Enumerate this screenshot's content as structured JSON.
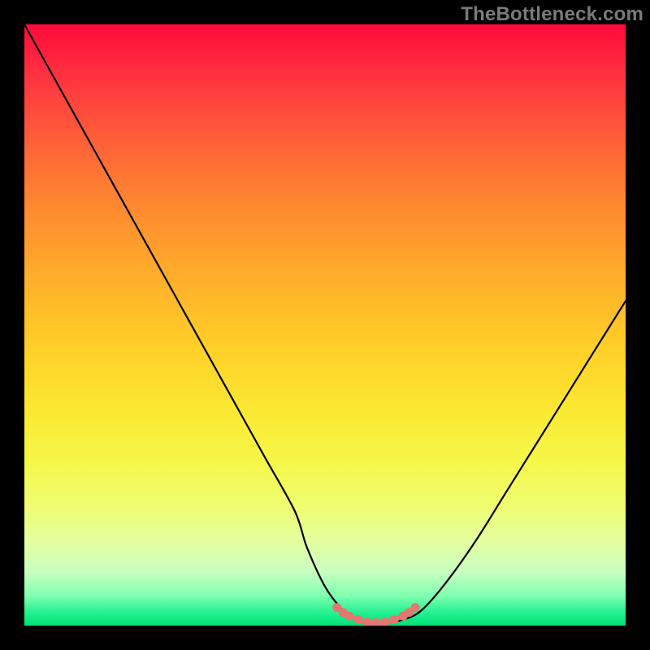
{
  "watermark": "TheBottleneck.com",
  "colors": {
    "frame": "#000000",
    "curve": "#000000",
    "marker": "#e4776f",
    "gradient_top": "#ff0a3a",
    "gradient_bottom": "#00e074"
  },
  "chart_data": {
    "type": "line",
    "title": "",
    "xlabel": "",
    "ylabel": "",
    "xlim": [
      0,
      100
    ],
    "ylim": [
      0,
      100
    ],
    "grid": false,
    "legend": false,
    "note": "No tick labels displayed; values are normalized percentages estimated from the rendered curve.",
    "series": [
      {
        "name": "bottleneck-curve",
        "x": [
          0,
          5,
          10,
          15,
          20,
          25,
          30,
          35,
          40,
          45,
          47,
          50,
          53,
          55,
          57,
          60,
          63,
          66,
          70,
          75,
          80,
          85,
          90,
          95,
          100
        ],
        "y": [
          100,
          91,
          82,
          73,
          64,
          55,
          46,
          37,
          28,
          19,
          13,
          6.5,
          2.5,
          1.0,
          0.5,
          0.5,
          1.0,
          2.5,
          7,
          14,
          22,
          30,
          38,
          46,
          54
        ]
      }
    ],
    "markers": {
      "name": "bottom-cluster",
      "color": "#e4776f",
      "points": [
        {
          "x": 52,
          "y": 3.0
        },
        {
          "x": 53,
          "y": 2.2
        },
        {
          "x": 54,
          "y": 1.6
        },
        {
          "x": 55.5,
          "y": 1.0
        },
        {
          "x": 57,
          "y": 0.6
        },
        {
          "x": 58.5,
          "y": 0.5
        },
        {
          "x": 60,
          "y": 0.6
        },
        {
          "x": 61.5,
          "y": 1.0
        },
        {
          "x": 63,
          "y": 1.6
        },
        {
          "x": 64,
          "y": 2.2
        },
        {
          "x": 65,
          "y": 3.0
        }
      ]
    }
  }
}
